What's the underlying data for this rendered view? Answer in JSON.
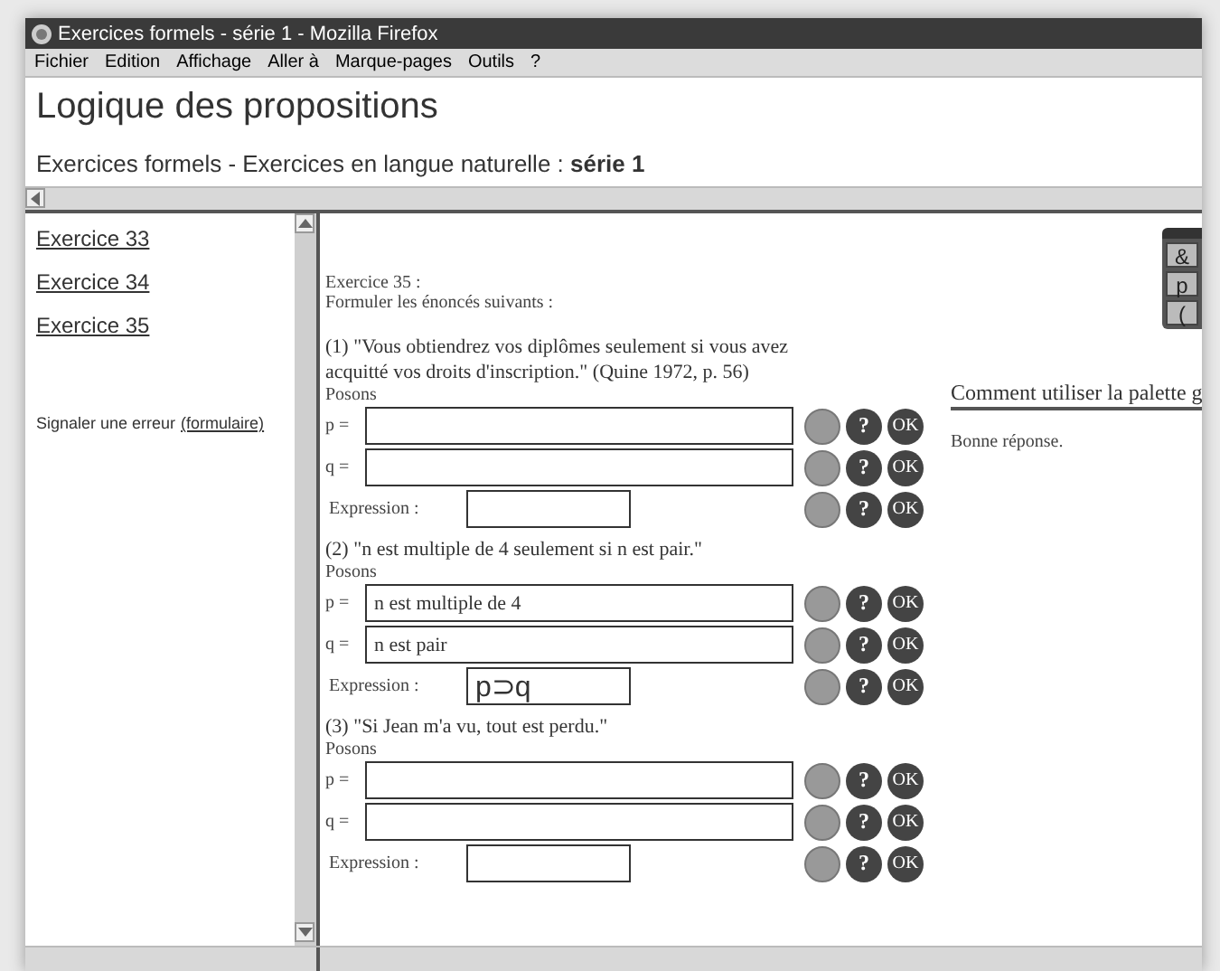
{
  "window": {
    "title": "Exercices formels - série 1 - Mozilla Firefox"
  },
  "menu": [
    "Fichier",
    "Edition",
    "Affichage",
    "Aller à",
    "Marque-pages",
    "Outils",
    "?"
  ],
  "page_title": "Logique des propositions",
  "subtitle": "Exercices formels - Exercices en langue naturelle : **série 1**",
  "sidebar": {
    "links": [
      "Exercice 33",
      "Exercice 34",
      "Exercice 35"
    ],
    "report_text": "Signaler une erreur",
    "report_link": "(formulaire)"
  },
  "content": {
    "heading": "Exercice 35 :",
    "instruction": "Formuler les énoncés suivants :",
    "exercises": [
      {
        "prompt": "(1) \"Vous obtiendrez vos diplômes seulement si vous avez acquitté vos droits d'inscription.\" (Quine 1972, p. 56)",
        "posons": "Posons",
        "fields": [
          {
            "kind": "variable",
            "label": "p =",
            "help": "?",
            "ok": "OK"
          },
          {
            "kind": "variable",
            "label": "q =",
            "help": "?",
            "ok": "OK"
          },
          {
            "kind": "expression",
            "label": "Expression :",
            "help": "?",
            "ok": "OK"
          }
        ]
      },
      {
        "prompt": "(2) \"n est multiple de 4 seulement si n est pair.\"",
        "posons": "Posons",
        "fields": [
          {
            "kind": "variable",
            "label": "p =",
            "value": "n est multiple de 4",
            "help": "?",
            "ok": "OK"
          },
          {
            "kind": "variable",
            "label": "q =",
            "value": "n est pair",
            "help": "?",
            "ok": "OK"
          },
          {
            "kind": "expression",
            "label": "Expression :",
            "value": "p⊃q",
            "help": "?",
            "ok": "OK"
          }
        ]
      },
      {
        "prompt": "(3) \"Si Jean m'a vu, tout est perdu.\"",
        "posons": "Posons",
        "fields": [
          {
            "kind": "variable",
            "label": "p =",
            "help": "?",
            "ok": "OK"
          },
          {
            "kind": "variable",
            "label": "q =",
            "help": "?",
            "ok": "OK"
          },
          {
            "kind": "expression",
            "label": "Expression :",
            "help": "?",
            "ok": "OK"
          }
        ]
      }
    ]
  },
  "side": {
    "palette_keys": [
      "&",
      "p",
      "("
    ],
    "help_link": "Comment utiliser la palette g",
    "feedback": "Bonne réponse."
  }
}
